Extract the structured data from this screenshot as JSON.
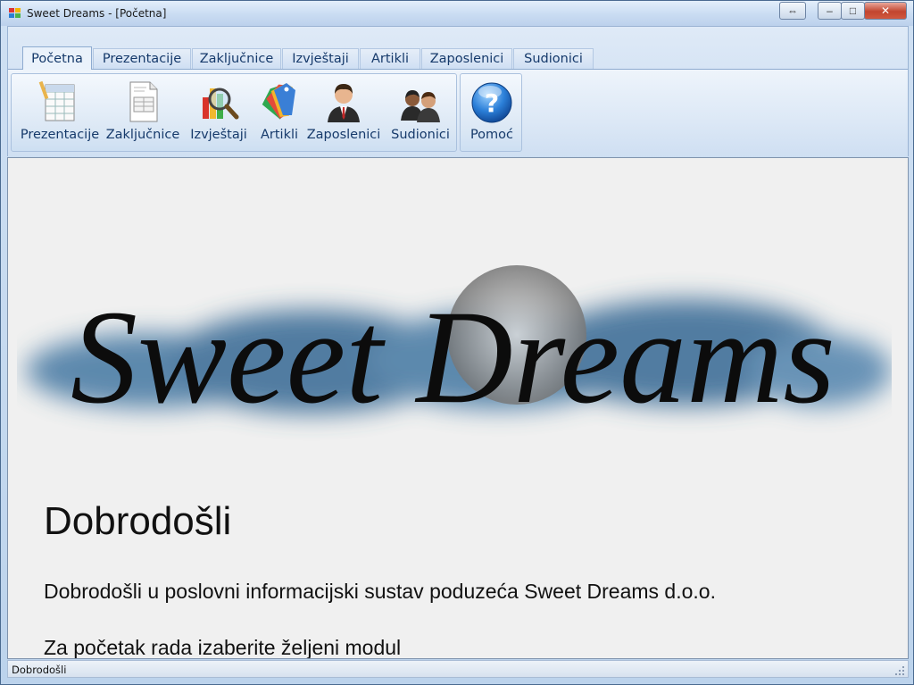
{
  "window": {
    "title": "Sweet Dreams - [Početna]",
    "controls": {
      "minimize": "–",
      "maximize": "□",
      "close": "✕",
      "restore": "⇔"
    }
  },
  "ribbon": {
    "tabs": [
      {
        "label": "Početna",
        "active": true
      },
      {
        "label": "Prezentacije"
      },
      {
        "label": "Zaključnice"
      },
      {
        "label": "Izvještaji"
      },
      {
        "label": "Artikli"
      },
      {
        "label": "Zaposlenici"
      },
      {
        "label": "Sudionici"
      }
    ],
    "buttons": [
      {
        "label": "Prezentacije",
        "icon": "spreadsheet-pencil-icon"
      },
      {
        "label": "Zaključnice",
        "icon": "document-table-icon"
      },
      {
        "label": "Izvještaji",
        "icon": "chart-magnifier-icon"
      },
      {
        "label": "Artikli",
        "icon": "tags-icon"
      },
      {
        "label": "Zaposlenici",
        "icon": "businessman-icon"
      },
      {
        "label": "Sudionici",
        "icon": "people-icon"
      }
    ],
    "help_button": {
      "label": "Pomoć",
      "icon": "help-icon"
    }
  },
  "content": {
    "logo_text": "Sweet Dreams",
    "heading": "Dobrodošli",
    "line1": "Dobrodošli u poslovni informacijski sustav poduzeća Sweet Dreams d.o.o.",
    "line2": "Za početak rada izaberite željeni modul"
  },
  "statusbar": {
    "text": "Dobrodošli"
  },
  "colors": {
    "accent": "#163a6b",
    "logo_cloud": "#4d7ea6",
    "content_bg": "#f0f0f0"
  }
}
